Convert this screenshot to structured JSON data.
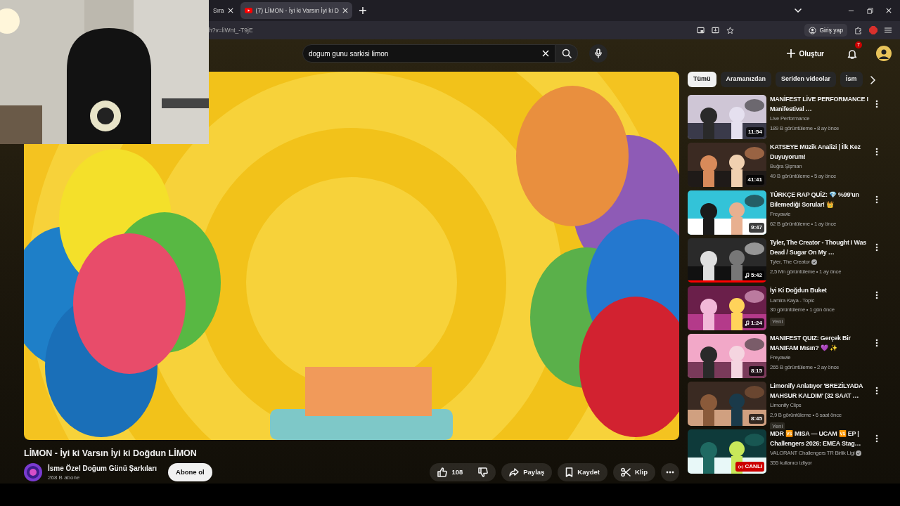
{
  "browser": {
    "tabs": [
      {
        "label": "Sıra",
        "selected": false
      },
      {
        "label": "(7) LİMON - İyi ki Varsın İyi ki D",
        "selected": true
      }
    ],
    "address": "h?v=liWnt_-T9jE",
    "sign_in": "Giriş yap"
  },
  "header": {
    "search": {
      "value": "dogum gunu sarkisi limon"
    },
    "create": "Oluştur",
    "notifications": "7"
  },
  "video": {
    "title": "LİMON - İyi ki Varsın İyi ki Doğdun LİMON",
    "channel": "İsme Özel Doğum Günü Şarkıları",
    "subscribers": "268 B abone",
    "subscribe": "Abone ol",
    "likes": "108",
    "actions": [
      {
        "kind": "share",
        "label": "Paylaş"
      },
      {
        "kind": "save",
        "label": "Kaydet"
      },
      {
        "kind": "clip",
        "label": "Klip"
      }
    ]
  },
  "chips": [
    {
      "label": "Tümü",
      "selected": true
    },
    {
      "label": "Aramanızdan",
      "selected": false
    },
    {
      "label": "Seriden videolar",
      "selected": false
    },
    {
      "label": "İsm",
      "selected": false
    }
  ],
  "recommendations": [
    {
      "title": "MANİFEST LİVE PERFORMANCE I Manifestival …",
      "channel": "Live Performance",
      "verified": false,
      "stats": "189 B görüntüleme • 8 ay önce",
      "duration": "11:54",
      "music": false
    },
    {
      "title": "KATSEYE Müzik Analizi | İlk Kez Duyuyorum!",
      "channel": "Buğra Şişman",
      "verified": false,
      "stats": "49 B görüntüleme • 5 ay önce",
      "duration": "41:41",
      "music": false
    },
    {
      "title": "TÜRKÇE RAP QUİZ: 💎 %99'un Bilemediği Sorular! 👑",
      "channel": "Freyawie",
      "verified": false,
      "stats": "62 B görüntüleme • 1 ay önce",
      "duration": "9:47",
      "music": false
    },
    {
      "title": "Tyler, The Creator - Thought I Was Dead / Sugar On My …",
      "channel": "Tyler, The Creator",
      "verified": true,
      "stats": "2,5 Mn görüntüleme • 1 ay önce",
      "duration": "5:42",
      "music": true,
      "level": 1
    },
    {
      "title": "İyi Ki Doğdun Buket",
      "channel": "Lamira Kaya - Topic",
      "verified": false,
      "stats": "30 görüntüleme • 1 gün önce",
      "duration": "1:24",
      "music": true,
      "badge": "Yeni"
    },
    {
      "title": "MANIFEST QUIZ: Gerçek Bir MANIFAM Mısın? 💜 ✨",
      "channel": "Freyawie",
      "verified": false,
      "stats": "265 B görüntüleme • 2 ay önce",
      "duration": "8:15",
      "music": false
    },
    {
      "title": "Limonify Anlatıyor 'BREZİLYADA MAHSUR KALDIM' (32 SAAT …",
      "channel": "Limonify Clips",
      "verified": false,
      "stats": "2,9 B görüntüleme • 6 saat önce",
      "duration": "8:45",
      "music": false,
      "badge": "Yeni"
    },
    {
      "title": "MDR 🆚 MISA — UCAM 🆚 EP | Challengers 2026: EMEA Stag…",
      "channel": "VALORANT Challengers TR Birlik Ligi",
      "verified": true,
      "stats": "355 kullanıcı izliyor",
      "live": "CANLI",
      "music": false
    }
  ]
}
